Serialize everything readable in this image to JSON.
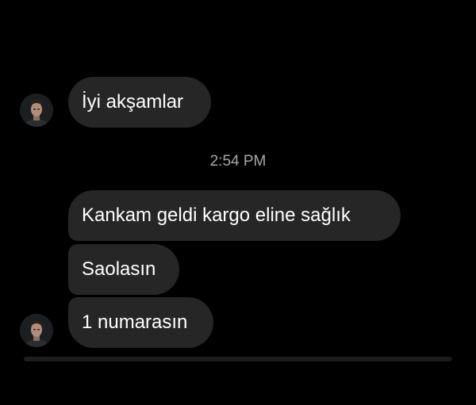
{
  "thread": {
    "messages_top": [
      {
        "text": "İyi akşamlar"
      }
    ],
    "timestamp": "2:54 PM",
    "messages_bottom": [
      {
        "text": "Kankam geldi kargo eline sağlık"
      },
      {
        "text": "Saolasın"
      },
      {
        "text": "1 numarasın"
      }
    ]
  },
  "colors": {
    "background": "#000000",
    "bubble": "#262626",
    "text": "#ffffff",
    "timestamp": "#a8a8a8"
  }
}
